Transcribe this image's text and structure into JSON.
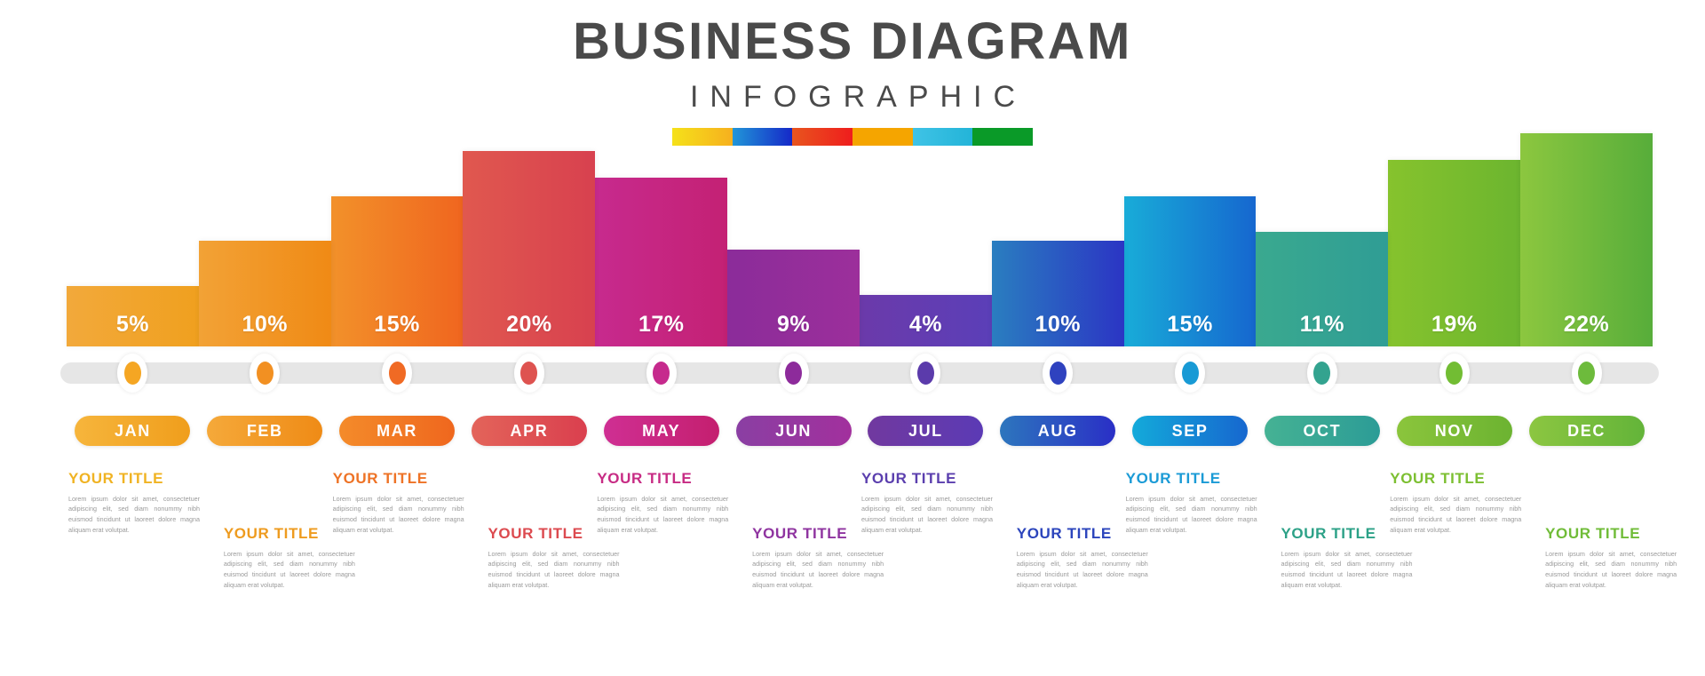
{
  "header": {
    "title": "BUSINESS DIAGRAM",
    "subtitle": "INFOGRAPHIC",
    "accent_segments": [
      {
        "name": "yellow",
        "from": "#f5e11a",
        "to": "#f6b01e"
      },
      {
        "name": "blue",
        "from": "#2196d8",
        "to": "#1528c8"
      },
      {
        "name": "red",
        "from": "#e8551e",
        "to": "#ef1d1d"
      },
      {
        "name": "orange",
        "from": "#f5a500",
        "to": "#f5a500"
      },
      {
        "name": "cyan",
        "from": "#3fc3e6",
        "to": "#23b4d8"
      },
      {
        "name": "green",
        "from": "#0a9a28",
        "to": "#0a9a28"
      }
    ]
  },
  "chart_data": {
    "type": "bar",
    "title": "BUSINESS DIAGRAM INFOGRAPHIC",
    "xlabel": "",
    "ylabel": "",
    "ylim": [
      0,
      22
    ],
    "grid": false,
    "legend": "none",
    "categories": [
      "JAN",
      "FEB",
      "MAR",
      "APR",
      "MAY",
      "JUN",
      "JUL",
      "AUG",
      "SEP",
      "OCT",
      "NOV",
      "DEC"
    ],
    "values": [
      5,
      10,
      15,
      20,
      17,
      9,
      4,
      10,
      15,
      11,
      19,
      22
    ],
    "labels": [
      "5%",
      "10%",
      "15%",
      "20%",
      "17%",
      "9%",
      "4%",
      "10%",
      "15%",
      "11%",
      "19%",
      "22%"
    ]
  },
  "months": [
    {
      "code": "JAN",
      "percent": "5%",
      "value": 5,
      "bar_from": "#f2a93b",
      "bar_to": "#f0a01f",
      "dot": "#f5a623",
      "pill_from": "#f6b53c",
      "pill_to": "#f09e1c",
      "title": "YOUR TITLE",
      "title_color": "#f0b323",
      "row": "top",
      "body": "Lorem ipsum dolor sit amet, consectetuer adipiscing elit, sed diam nonummy nibh euismod tincidunt ut laoreet dolore magna aliquam erat volutpat."
    },
    {
      "code": "FEB",
      "percent": "10%",
      "value": 10,
      "bar_from": "#f2a236",
      "bar_to": "#f08a15",
      "dot": "#f29022",
      "pill_from": "#f5a93a",
      "pill_to": "#ef8b16",
      "title": "YOUR TITLE",
      "title_color": "#ee9b1f",
      "row": "bottom",
      "body": "Lorem ipsum dolor sit amet, consectetuer adipiscing elit, sed diam nonummy nibh euismod tincidunt ut laoreet dolore magna aliquam erat volutpat."
    },
    {
      "code": "MAR",
      "percent": "15%",
      "value": 15,
      "bar_from": "#f2912a",
      "bar_to": "#f0661f",
      "dot": "#f06a24",
      "pill_from": "#f48b2a",
      "pill_to": "#ef671e",
      "title": "YOUR TITLE",
      "title_color": "#ee7326",
      "row": "top",
      "body": "Lorem ipsum dolor sit amet, consectetuer adipiscing elit, sed diam nonummy nibh euismod tincidunt ut laoreet dolore magna aliquam erat volutpat."
    },
    {
      "code": "APR",
      "percent": "20%",
      "value": 20,
      "bar_from": "#e0584f",
      "bar_to": "#d8414f",
      "dot": "#de5350",
      "pill_from": "#e3645a",
      "pill_to": "#da3f4e",
      "title": "YOUR TITLE",
      "title_color": "#dc4a4f",
      "row": "bottom",
      "body": "Lorem ipsum dolor sit amet, consectetuer adipiscing elit, sed diam nonummy nibh euismod tincidunt ut laoreet dolore magna aliquam erat volutpat."
    },
    {
      "code": "MAY",
      "percent": "17%",
      "value": 17,
      "bar_from": "#c72a8e",
      "bar_to": "#c42174",
      "dot": "#c62a8d",
      "pill_from": "#cf2f93",
      "pill_to": "#c41f6f",
      "title": "YOUR TITLE",
      "title_color": "#c72b84",
      "row": "top",
      "body": "Lorem ipsum dolor sit amet, consectetuer adipiscing elit, sed diam nonummy nibh euismod tincidunt ut laoreet dolore magna aliquam erat volutpat."
    },
    {
      "code": "JUN",
      "percent": "9%",
      "value": 9,
      "bar_from": "#8b2c9a",
      "bar_to": "#9c2f9b",
      "dot": "#8d2b9b",
      "pill_from": "#8a3fa3",
      "pill_to": "#a2309d",
      "title": "YOUR TITLE",
      "title_color": "#8f34a0",
      "row": "bottom",
      "body": "Lorem ipsum dolor sit amet, consectetuer adipiscing elit, sed diam nonummy nibh euismod tincidunt ut laoreet dolore magna aliquam erat volutpat."
    },
    {
      "code": "JUL",
      "percent": "4%",
      "value": 4,
      "bar_from": "#6b3aaa",
      "bar_to": "#5b3fb8",
      "dot": "#5b3bab",
      "pill_from": "#71399f",
      "pill_to": "#5b3ab5",
      "title": "YOUR TITLE",
      "title_color": "#5b3fae",
      "row": "top",
      "body": "Lorem ipsum dolor sit amet, consectetuer adipiscing elit, sed diam nonummy nibh euismod tincidunt ut laoreet dolore magna aliquam erat volutpat."
    },
    {
      "code": "AUG",
      "percent": "10%",
      "value": 10,
      "bar_from": "#2a7ec0",
      "bar_to": "#2b35c4",
      "dot": "#2f42bf",
      "pill_from": "#2d76bd",
      "pill_to": "#2a2fc6",
      "title": "YOUR TITLE",
      "title_color": "#2c45bc",
      "row": "bottom",
      "body": "Lorem ipsum dolor sit amet, consectetuer adipiscing elit, sed diam nonummy nibh euismod tincidunt ut laoreet dolore magna aliquam erat volutpat."
    },
    {
      "code": "SEP",
      "percent": "15%",
      "value": 15,
      "bar_from": "#18acd8",
      "bar_to": "#1667cf",
      "dot": "#189ad5",
      "pill_from": "#14aada",
      "pill_to": "#1667cf",
      "title": "YOUR TITLE",
      "title_color": "#1b9bd6",
      "row": "top",
      "body": "Lorem ipsum dolor sit amet, consectetuer adipiscing elit, sed diam nonummy nibh euismod tincidunt ut laoreet dolore magna aliquam erat volutpat."
    },
    {
      "code": "OCT",
      "percent": "11%",
      "value": 11,
      "bar_from": "#3aa98f",
      "bar_to": "#2f9d95",
      "dot": "#33a38f",
      "pill_from": "#45b294",
      "pill_to": "#2c9c96",
      "title": "YOUR TITLE",
      "title_color": "#2ca187",
      "row": "bottom",
      "body": "Lorem ipsum dolor sit amet, consectetuer adipiscing elit, sed diam nonummy nibh euismod tincidunt ut laoreet dolore magna aliquam erat volutpat."
    },
    {
      "code": "NOV",
      "percent": "19%",
      "value": 19,
      "bar_from": "#86c32d",
      "bar_to": "#6cb52f",
      "dot": "#72bd33",
      "pill_from": "#8bc53c",
      "pill_to": "#6cb331",
      "title": "YOUR TITLE",
      "title_color": "#7cbf31",
      "row": "top",
      "body": "Lorem ipsum dolor sit amet, consectetuer adipiscing elit, sed diam nonummy nibh euismod tincidunt ut laoreet dolore magna aliquam erat volutpat."
    },
    {
      "code": "DEC",
      "percent": "22%",
      "value": 22,
      "bar_from": "#8cc73f",
      "bar_to": "#57ad3a",
      "dot": "#6dbb3c",
      "pill_from": "#8cc641",
      "pill_to": "#63b439",
      "title": "YOUR TITLE",
      "title_color": "#70bc38",
      "row": "bottom",
      "body": "Lorem ipsum dolor sit amet, consectetuer adipiscing elit, sed diam nonummy nibh euismod tincidunt ut laoreet dolore magna aliquam erat volutpat."
    }
  ]
}
